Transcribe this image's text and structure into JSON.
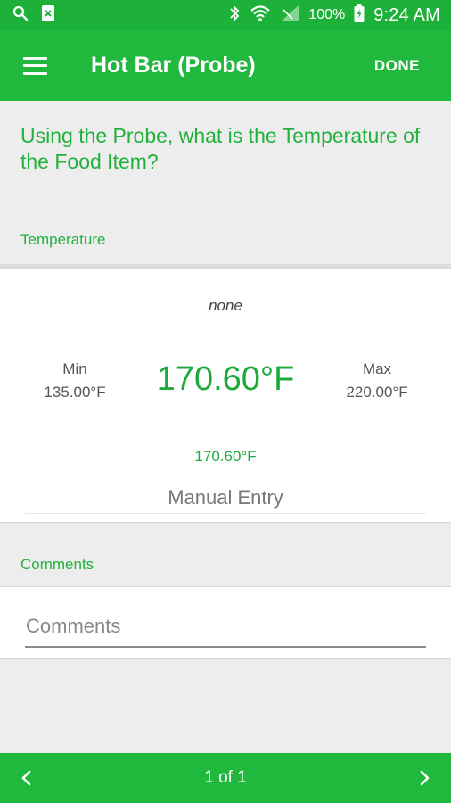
{
  "status_bar": {
    "battery_text": "100%",
    "time": "9:24 AM",
    "icons": [
      "search-icon",
      "image-icon",
      "bluetooth-icon",
      "wifi-icon",
      "signal-icon",
      "battery-charging-icon"
    ]
  },
  "app_bar": {
    "title": "Hot Bar (Probe)",
    "done_label": "DONE"
  },
  "question": "Using the Probe, what is the Temperature of the Food Item?",
  "temperature": {
    "section_label": "Temperature",
    "note": "none",
    "min_label": "Min",
    "min_value": "135.00°F",
    "max_label": "Max",
    "max_value": "220.00°F",
    "current": "170.60°F",
    "reading": "170.60°F",
    "manual_entry": "Manual Entry"
  },
  "comments": {
    "section_label": "Comments",
    "placeholder": "Comments",
    "value": ""
  },
  "footer": {
    "page_indicator": "1 of 1"
  },
  "colors": {
    "primary": "#21b83e",
    "accent_text": "#22b13d"
  }
}
